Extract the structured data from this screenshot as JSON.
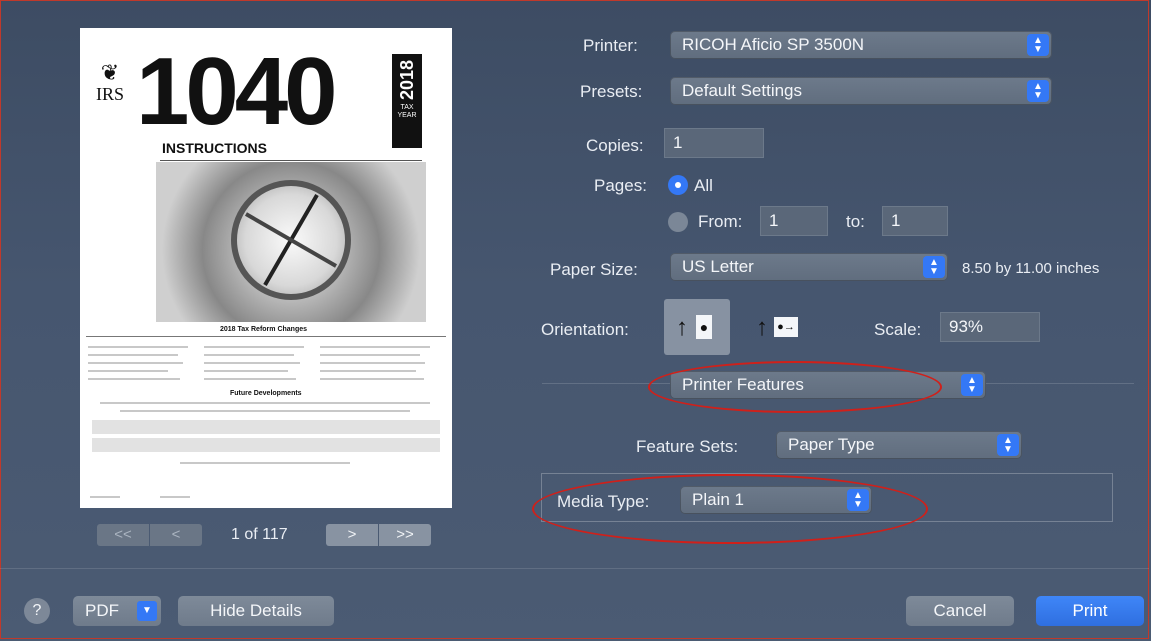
{
  "printer": {
    "label": "Printer:",
    "value": "RICOH Aficio SP 3500N"
  },
  "presets": {
    "label": "Presets:",
    "value": "Default Settings"
  },
  "copies": {
    "label": "Copies:",
    "value": "1"
  },
  "pages": {
    "label": "Pages:",
    "all_label": "All",
    "from_label": "From:",
    "from_value": "1",
    "to_label": "to:",
    "to_value": "1",
    "selected": "All"
  },
  "paper_size": {
    "label": "Paper Size:",
    "value": "US Letter",
    "dimensions": "8.50 by 11.00 inches"
  },
  "orientation": {
    "label": "Orientation:",
    "portrait_icon": "portrait-icon",
    "landscape_icon": "landscape-icon"
  },
  "scale": {
    "label": "Scale:",
    "value": "93%"
  },
  "section_popup": {
    "value": "Printer Features"
  },
  "feature_sets": {
    "label": "Feature Sets:",
    "value": "Paper Type"
  },
  "media_type": {
    "label": "Media Type:",
    "value": "Plain 1"
  },
  "preview": {
    "page_indicator": "1 of 117",
    "doc_logo": "IRS",
    "doc_number": "1040",
    "doc_year": "2018",
    "doc_tax_year": "TAX YEAR",
    "doc_heading": "INSTRUCTIONS",
    "doc_section1": "2018 Tax Reform Changes",
    "doc_section2": "Future Developments",
    "nav_first": "<<",
    "nav_prev": "<",
    "nav_next": ">",
    "nav_last": ">>"
  },
  "footer": {
    "help": "?",
    "pdf": "PDF",
    "hide_details": "Hide Details",
    "cancel": "Cancel",
    "print": "Print"
  },
  "colors": {
    "accent": "#3478f6",
    "annotation": "#d0201a",
    "background": "#46566f"
  }
}
